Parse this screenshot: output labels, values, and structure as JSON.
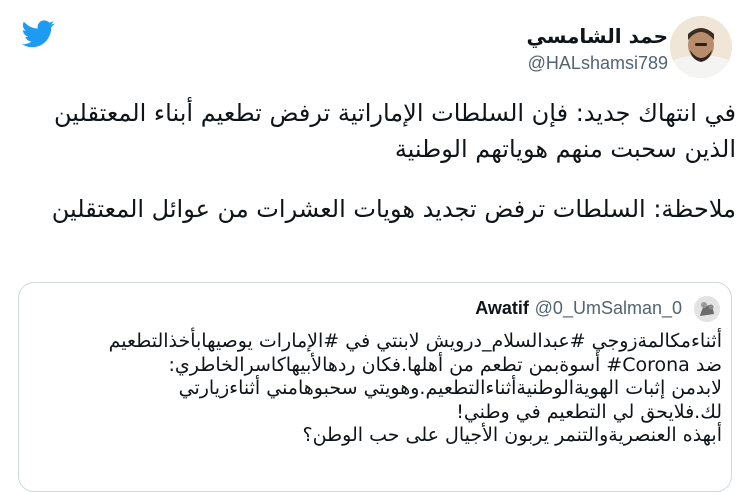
{
  "colors": {
    "brand": "#1d9bf0",
    "text": "#0f1419",
    "muted": "#536471",
    "border": "#cfd9de"
  },
  "header": {
    "logo_icon": "twitter-bird-icon",
    "author_name": "حمد الشامسي",
    "author_handle": "@HALshamsi789"
  },
  "tweet": {
    "paragraphs": [
      "في انتهاك جديد: فإن السلطات الإماراتية ترفض تطعيم أبناء المعتقلين الذين سحبت منهم هوياتهم الوطنية",
      "ملاحظة: السلطات ترفض تجديد هويات العشرات من عوائل المعتقلين"
    ]
  },
  "quoted": {
    "name": "Awatif",
    "handle": "@0_UmSalman_0",
    "lines": [
      "أثناءمكالمةزوجي #عبدالسلام_درويش لابنتي في #الإمارات يوصيهابأخذالتطعيم",
      "ضد Corona# أسوةبمن تطعم من أهلها.فكان ردهالأبيهاكاسرالخاطري:",
      "لابدمن إثبات الهويةالوطنيةأثناءالتطعيم.وهويتي سحبوهامني أثناءزيارتي",
      "لك.فلايحق لي التطعيم في وطني!",
      "أبهذه العنصريةوالتنمر يربون الأجيال على حب الوطن؟"
    ]
  }
}
